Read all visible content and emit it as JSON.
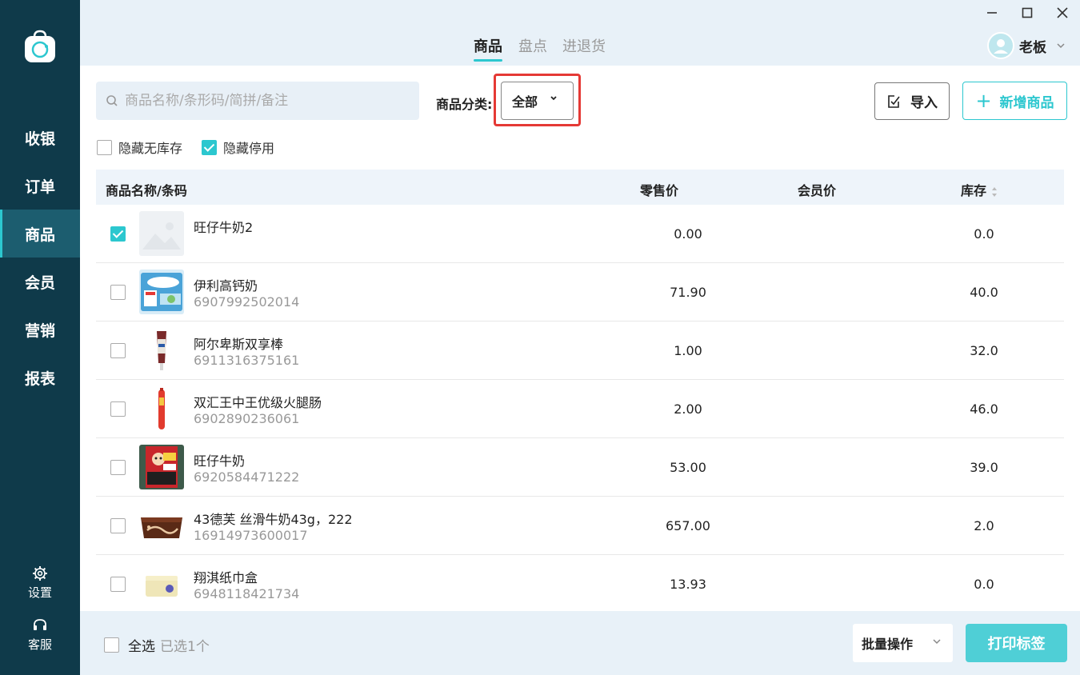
{
  "sidebar": {
    "logo": "shopping-bag-logo",
    "items": [
      {
        "label": "收银",
        "active": false
      },
      {
        "label": "订单",
        "active": false
      },
      {
        "label": "商品",
        "active": true
      },
      {
        "label": "会员",
        "active": false
      },
      {
        "label": "营销",
        "active": false
      },
      {
        "label": "报表",
        "active": false
      }
    ],
    "settings_label": "设置",
    "support_label": "客服"
  },
  "header": {
    "tabs": [
      {
        "label": "商品",
        "active": true
      },
      {
        "label": "盘点",
        "active": false
      },
      {
        "label": "进退货",
        "active": false
      }
    ],
    "user_name": "老板"
  },
  "toolbar": {
    "search_placeholder": "商品名称/条形码/简拼/备注",
    "category_label": "商品分类:",
    "category_value": "全部",
    "import_label": "导入",
    "add_label": "新增商品"
  },
  "filters": {
    "hide_no_stock": {
      "label": "隐藏无库存",
      "checked": false
    },
    "hide_disabled": {
      "label": "隐藏停用",
      "checked": true
    }
  },
  "table": {
    "columns": {
      "name": "商品名称/条码",
      "retail": "零售价",
      "member": "会员价",
      "stock": "库存"
    },
    "rows": [
      {
        "name": "旺仔牛奶2",
        "code": "",
        "retail": "0.00",
        "member": "",
        "stock": "0.0",
        "checked": true,
        "thumb": "placeholder-image"
      },
      {
        "name": "伊利高钙奶",
        "code": "6907992502014",
        "retail": "71.90",
        "member": "",
        "stock": "40.0",
        "checked": false,
        "thumb": "milk-box"
      },
      {
        "name": "阿尔卑斯双享棒",
        "code": "6911316375161",
        "retail": "1.00",
        "member": "",
        "stock": "32.0",
        "checked": false,
        "thumb": "candy-stick"
      },
      {
        "name": "双汇王中王优级火腿肠",
        "code": "6902890236061",
        "retail": "2.00",
        "member": "",
        "stock": "46.0",
        "checked": false,
        "thumb": "sausage"
      },
      {
        "name": "旺仔牛奶",
        "code": "6920584471222",
        "retail": "53.00",
        "member": "",
        "stock": "39.0",
        "checked": false,
        "thumb": "milk-can"
      },
      {
        "name": "43德芙 丝滑牛奶43g，222",
        "code": "16914973600017",
        "retail": "657.00",
        "member": "",
        "stock": "2.0",
        "checked": false,
        "thumb": "chocolate"
      },
      {
        "name": "翔淇纸巾盒",
        "code": "6948118421734",
        "retail": "13.93",
        "member": "",
        "stock": "0.0",
        "checked": false,
        "thumb": "tissue-box"
      }
    ]
  },
  "footer": {
    "select_all_label": "全选",
    "selected_text": "已选1个",
    "batch_label": "批量操作",
    "print_label": "打印标签"
  },
  "colors": {
    "sidebar_bg": "#0f3a4a",
    "accent": "#2cc7cf",
    "highlight": "#e53935"
  }
}
